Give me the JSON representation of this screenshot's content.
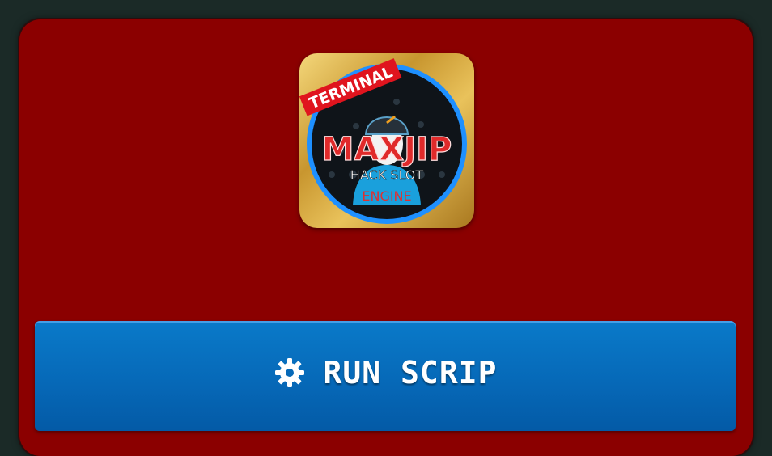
{
  "logo": {
    "banner_text": "TERMINAL",
    "brand_text": "MAXJIP",
    "subtitle_text": "HACK SLOT",
    "engine_text": "ENGINE"
  },
  "run_button": {
    "label": "RUN SCRIP",
    "icon": "gear-icon"
  },
  "colors": {
    "page_bg": "#1b2a27",
    "panel_bg": "#8b0000",
    "button_bg": "#0669b8",
    "logo_gold": "#c8962f",
    "logo_ring": "#1e90ff",
    "banner_red": "#e0141e"
  }
}
